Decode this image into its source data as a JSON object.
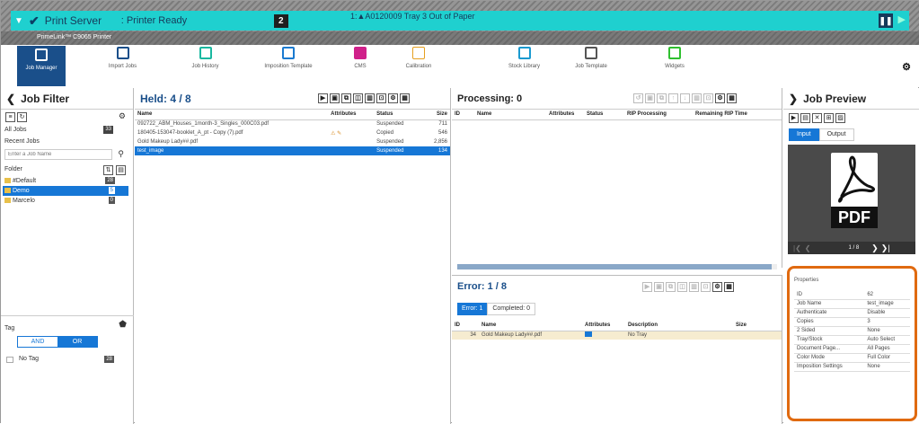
{
  "header": {
    "server": "Print Server",
    "status": ": Printer Ready",
    "count": "2",
    "alert": "1:▲A0120009 Tray 3 Out of Paper",
    "printer": "PrimeLink™ C9065 Printer"
  },
  "toolbar": {
    "items": [
      {
        "label": "Job Manager"
      },
      {
        "label": "Import Jobs"
      },
      {
        "label": "Job History"
      },
      {
        "label": "Imposition Template"
      },
      {
        "label": "CMS"
      },
      {
        "label": "Calibration"
      },
      {
        "label": "Stock Library"
      },
      {
        "label": "Job Template"
      },
      {
        "label": "Widgets"
      }
    ]
  },
  "filter": {
    "title": "Job Filter",
    "all_jobs": "All Jobs",
    "all_count": "33",
    "recent": "Recent Jobs",
    "search_placeholder": "Enter a Job Name",
    "folder": "Folder",
    "folders": [
      {
        "name": "#Default",
        "count": "28"
      },
      {
        "name": "Demo",
        "count": "5"
      },
      {
        "name": "Marcelo",
        "count": "0"
      }
    ],
    "tag": "Tag",
    "and": "AND",
    "or": "OR",
    "no_tag": "No Tag",
    "no_tag_count": "28"
  },
  "held": {
    "title": "Held: 4 / 8",
    "columns": [
      "Name",
      "Attributes",
      "Status",
      "Size"
    ],
    "rows": [
      {
        "name": "092722_ABM_Houses_1month-3_Singles_000C03.pdf",
        "attr": "",
        "status": "Suspended",
        "size": "711"
      },
      {
        "name": "180405-153047-booklet_A_pt - Copy (7).pdf",
        "attr": "⚠ ✎",
        "status": "Copied",
        "size": "546"
      },
      {
        "name": "Gold Makeup Lady##.pdf",
        "attr": "",
        "status": "Suspended",
        "size": "2,856"
      },
      {
        "name": "test_image",
        "attr": "",
        "status": "Suspended",
        "size": "134"
      }
    ]
  },
  "processing": {
    "title": "Processing: 0",
    "columns": [
      "ID",
      "Name",
      "Attributes",
      "Status",
      "RIP Processing",
      "Remaining RIP Time"
    ]
  },
  "errors": {
    "title": "Error: 1 / 8",
    "tab_error": "Error: 1",
    "tab_completed": "Completed: 0",
    "columns": [
      "ID",
      "Name",
      "Attributes",
      "Description",
      "Size"
    ],
    "rows": [
      {
        "id": "34",
        "name": "Gold Makeup Lady##.pdf",
        "attr": "",
        "desc": "No Tray"
      }
    ]
  },
  "preview": {
    "title": "Job Preview",
    "tab_input": "Input",
    "tab_output": "Output",
    "pdf_label": "PDF",
    "page": "1 / 8",
    "properties_title": "Properties",
    "props": [
      {
        "k": "ID",
        "v": "62"
      },
      {
        "k": "Job Name",
        "v": "test_image"
      },
      {
        "k": "Authenticate",
        "v": "Disable"
      },
      {
        "k": "Copies",
        "v": "3"
      },
      {
        "k": "2 Sided",
        "v": "None"
      },
      {
        "k": "Tray/Stock",
        "v": "Auto Select"
      },
      {
        "k": "Document Page...",
        "v": "All Pages"
      },
      {
        "k": "Color Mode",
        "v": "Full Color"
      },
      {
        "k": "Imposition Settings",
        "v": "None"
      }
    ]
  },
  "colors": {
    "accent": "#1a4f8a",
    "status": "#1fd0cf",
    "highlight": "#e06a10",
    "select": "#1677d6"
  }
}
